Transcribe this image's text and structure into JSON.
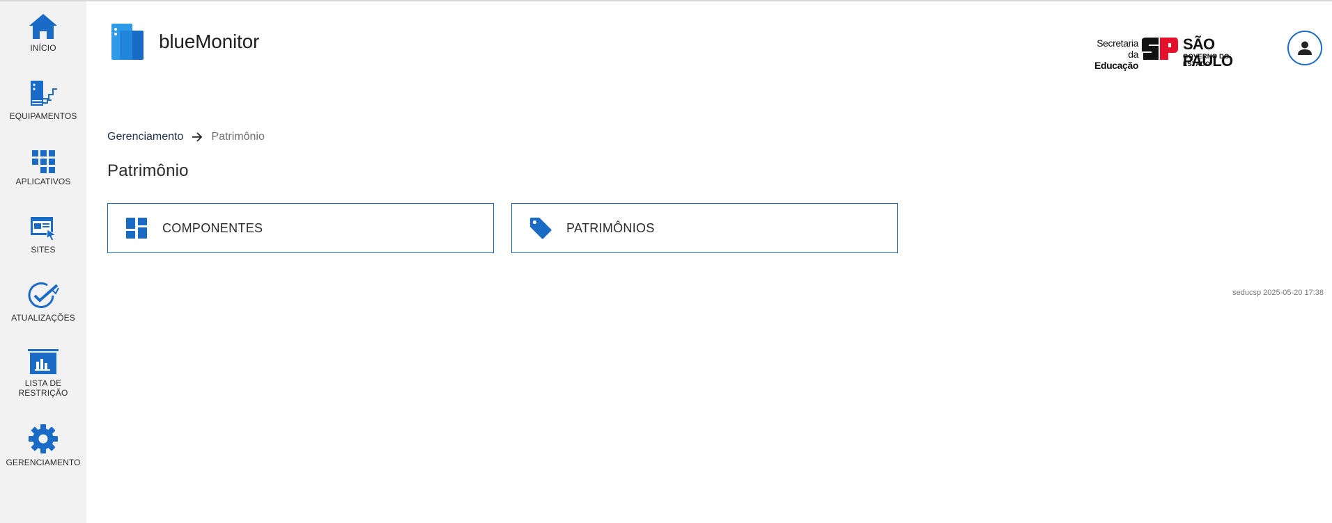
{
  "app": {
    "brand_name": "blueMonitor"
  },
  "colors": {
    "accent": "#1a6bc6",
    "sidebar_bg": "#f2f2f2"
  },
  "sidebar": {
    "items": [
      {
        "label": "INÍCIO",
        "icon": "home-icon"
      },
      {
        "label": "EQUIPAMENTOS",
        "icon": "server-icon"
      },
      {
        "label": "APLICATIVOS",
        "icon": "apps-grid-icon"
      },
      {
        "label": "SITES",
        "icon": "website-cursor-icon"
      },
      {
        "label": "ATUALIZAÇÕES",
        "icon": "update-check-icon"
      },
      {
        "label": "LISTA DE RESTRIÇÃO",
        "icon": "restriction-list-icon"
      },
      {
        "label": "GERENCIAMENTO",
        "icon": "gear-icon"
      }
    ]
  },
  "header": {
    "gov_logo": {
      "line1": "Secretaria da",
      "line2": "Educação",
      "title": "SÃO PAULO",
      "subtitle": "GOVERNO DO ESTADO"
    },
    "user_icon": "person-icon"
  },
  "breadcrumb": {
    "parent": "Gerenciamento",
    "current": "Patrimônio"
  },
  "page": {
    "title": "Patrimônio"
  },
  "cards": [
    {
      "label": "COMPONENTES",
      "icon": "dashboard-icon"
    },
    {
      "label": "PATRIMÔNIOS",
      "icon": "tag-icon"
    }
  ],
  "footer": {
    "stamp": "seducsp 2025-05-20 17:38"
  }
}
